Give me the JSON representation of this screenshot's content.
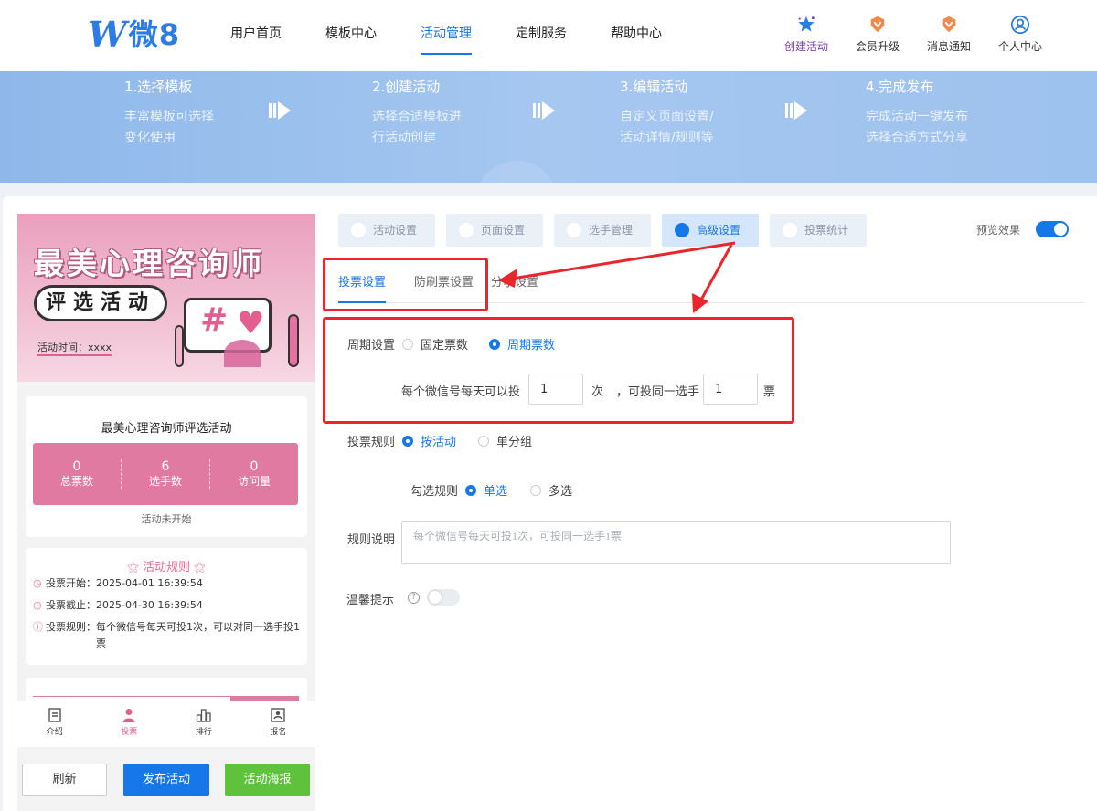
{
  "header": {
    "logo_mark": "W",
    "logo_text": "微8",
    "nav": [
      {
        "label": "用户首页"
      },
      {
        "label": "模板中心"
      },
      {
        "label": "活动管理"
      },
      {
        "label": "定制服务"
      },
      {
        "label": "帮助中心"
      }
    ],
    "tools": [
      {
        "label": "创建活动",
        "icon": "star-icon"
      },
      {
        "label": "会员升级",
        "icon": "diamond-icon"
      },
      {
        "label": "消息通知",
        "icon": "bell-icon"
      },
      {
        "label": "个人中心",
        "icon": "user-icon"
      }
    ]
  },
  "steps": [
    {
      "title": "1.选择模板",
      "line1": "丰富模板可选择",
      "line2": "变化使用"
    },
    {
      "title": "2.创建活动",
      "line1": "选择合适模板进",
      "line2": "行活动创建"
    },
    {
      "title": "3.编辑活动",
      "line1": "自定义页面设置/",
      "line2": "活动详情/规则等"
    },
    {
      "title": "4.完成发布",
      "line1": "完成活动一键发布",
      "line2": "选择合适方式分享"
    }
  ],
  "preview": {
    "poster_title": "最美心理咨询师",
    "poster_subtitle": "评选活动",
    "poster_time": "活动时间：xxxx",
    "poster_hash": "#",
    "activity_name": "最美心理咨询师评选活动",
    "stats": [
      {
        "value": "0",
        "label": "总票数"
      },
      {
        "value": "6",
        "label": "选手数"
      },
      {
        "value": "0",
        "label": "访问量"
      }
    ],
    "status": "活动未开始",
    "rules_title": "活动规则",
    "rules": [
      {
        "label": "投票开始：",
        "value": "2025-04-01 16:39:54"
      },
      {
        "label": "投票截止：",
        "value": "2025-04-30 16:39:54"
      },
      {
        "label": "投票规则：",
        "value": "每个微信号每天可投1次，可以对同一选手投1票"
      }
    ],
    "tabbar": [
      {
        "label": "介绍"
      },
      {
        "label": "投票"
      },
      {
        "label": "排行"
      },
      {
        "label": "报名"
      }
    ]
  },
  "buttons": {
    "refresh": "刷新",
    "publish": "发布活动",
    "poster": "活动海报"
  },
  "settings": {
    "tabs": [
      {
        "label": "活动设置"
      },
      {
        "label": "页面设置"
      },
      {
        "label": "选手管理"
      },
      {
        "label": "高级设置"
      },
      {
        "label": "投票统计"
      }
    ],
    "preview_label": "预览效果",
    "preview_on": true,
    "subtabs": [
      {
        "label": "投票设置"
      },
      {
        "label": "防刷票设置"
      },
      {
        "label": "分享设置"
      }
    ],
    "cycle": {
      "label": "周期设置",
      "option_fixed": "固定票数",
      "option_cycle": "周期票数",
      "selected": "周期票数",
      "per_day_text": "每个微信号每天可以投",
      "times_value": "1",
      "times_unit": "次",
      "same_player_text": "，可投同一选手",
      "votes_value": "1",
      "votes_unit": "票"
    },
    "vote_rule": {
      "label": "投票规则",
      "option_activity": "按活动",
      "option_group": "单分组",
      "selected": "按活动"
    },
    "check_rule": {
      "label": "勾选规则",
      "option_single": "单选",
      "option_multi": "多选",
      "selected": "单选"
    },
    "rule_desc": {
      "label": "规则说明",
      "placeholder": "每个微信号每天可投1次，可投同一选手1票"
    },
    "tips": {
      "label": "温馨提示",
      "help": "?",
      "enabled": false
    }
  },
  "colors": {
    "brand": "#1677e8",
    "pink": "#e07aa1",
    "green": "#5ec23d",
    "annotation_red": "#e8262b"
  }
}
